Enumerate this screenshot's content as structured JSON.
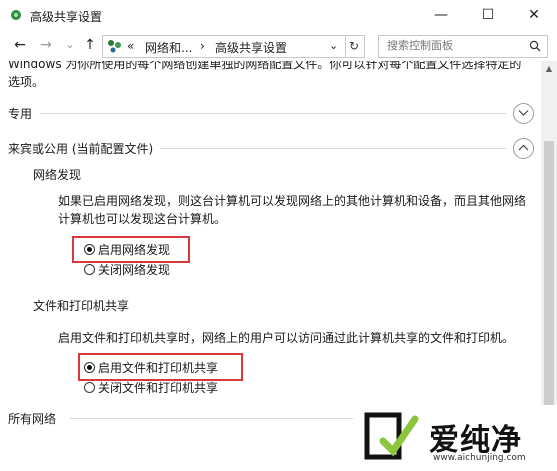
{
  "window": {
    "title": "高级共享设置",
    "minimize": "—",
    "maximize": "☐",
    "close": "✕"
  },
  "nav": {
    "back": "←",
    "forward": "→",
    "history": "⌄",
    "up": "↑",
    "breadcrumb": [
      "«",
      "网络和...",
      "›",
      "高级共享设置"
    ],
    "address_dropdown": "⌄",
    "refresh": "↻",
    "search_placeholder": "搜索控制面板"
  },
  "content": {
    "truncated_text": "Windows 为你所使用的每个网络创建单独的网络配置文件。你可以针对每个配置文件选择特定的选项。",
    "profiles": {
      "private": {
        "label": "专用",
        "expanded": false
      },
      "guest_public": {
        "label": "来宾或公用 (当前配置文件)",
        "expanded": true
      },
      "all_networks": {
        "label": "所有网络",
        "expanded": false
      }
    },
    "network_discovery": {
      "title": "网络发现",
      "description": "如果已启用网络发现，则这台计算机可以发现网络上的其他计算机和设备，而且其他网络计算机也可以发现这台计算机。",
      "options": [
        {
          "label": "启用网络发现",
          "checked": true
        },
        {
          "label": "关闭网络发现",
          "checked": false
        }
      ]
    },
    "file_printer_sharing": {
      "title": "文件和打印机共享",
      "description": "启用文件和打印机共享时，网络上的用户可以访问通过此计算机共享的文件和打印机。",
      "options": [
        {
          "label": "启用文件和打印机共享",
          "checked": true
        },
        {
          "label": "关闭文件和打印机共享",
          "checked": false
        }
      ]
    }
  },
  "watermark": {
    "name": "爱纯净",
    "url": "www.aichunjing.com"
  },
  "colors": {
    "highlight": "#d9363e",
    "text": "#1a1a1a",
    "rule": "#d6d6d6"
  }
}
